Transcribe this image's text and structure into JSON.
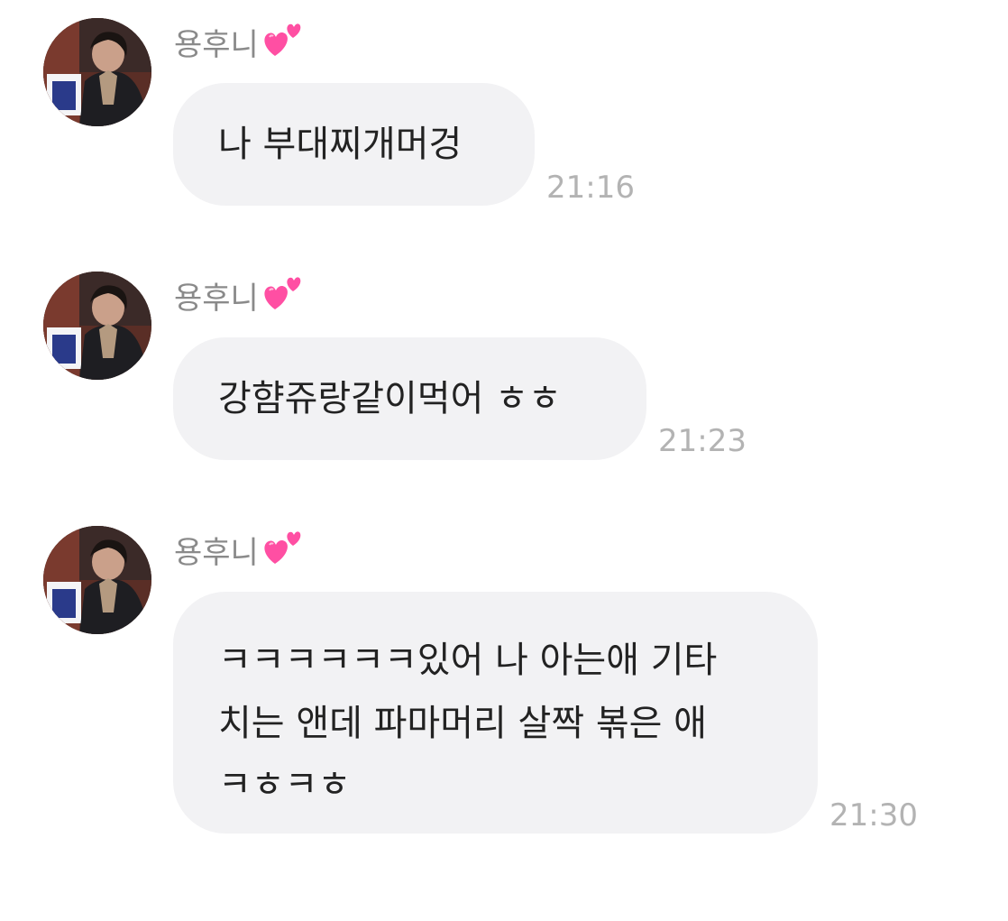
{
  "messages": [
    {
      "sender": "용후니",
      "text": "나 부대찌개머겅",
      "time": "21:16"
    },
    {
      "sender": "용후니",
      "text": "강햠쥬랑같이먹어 ㅎㅎ",
      "time": "21:23"
    },
    {
      "sender": "용후니",
      "lines": [
        "ㅋㅋㅋㅋㅋㅋ있어 나 아는애 기타",
        "치는 앤데 파마머리 살짝 볶은 애",
        "ㅋㅎㅋㅎ"
      ],
      "time": "21:30"
    }
  ],
  "icons": {
    "sender_badge": "two-hearts-icon",
    "avatar": "profile-photo-avatar"
  },
  "colors": {
    "bubble": "#f2f2f4",
    "sender_text": "#8a8a8a",
    "time_text": "#b3b3b3",
    "message_text": "#222222",
    "heart": "#ff4fa3"
  }
}
